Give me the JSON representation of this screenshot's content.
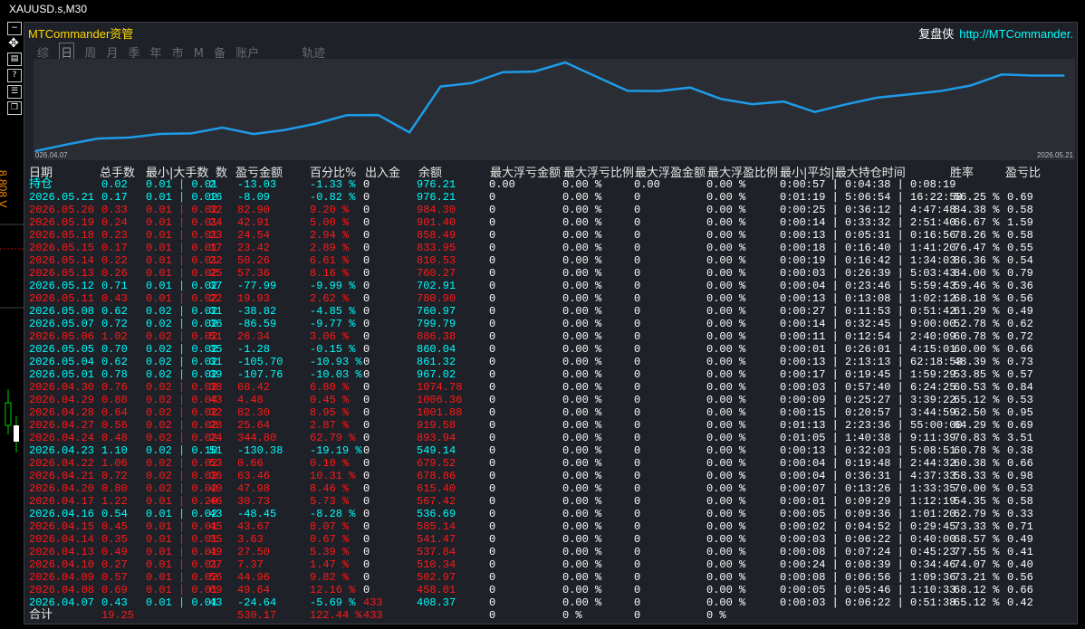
{
  "window": {
    "title": "XAUUSD.s,M30"
  },
  "toolbar_icons": [
    "minimize-icon",
    "move-icon",
    "table-icon",
    "help-icon",
    "settings-icon",
    "restore-icon"
  ],
  "side_label": "8.808 V",
  "panel": {
    "title": "MTCommander资管",
    "brand": "复盘侠",
    "url": "http://MTCommander."
  },
  "tabs": [
    "综",
    "日",
    "周",
    "月",
    "季",
    "年",
    "市",
    "M",
    "备",
    "账户",
    "轨迹"
  ],
  "active_tab": "日",
  "chart_data": {
    "type": "line",
    "x_start_label": "026.04.07",
    "x_end_label": "2026.05.21",
    "x": [
      "2026.04.07",
      "2026.04.08",
      "2026.04.09",
      "2026.04.10",
      "2026.04.13",
      "2026.04.14",
      "2026.04.15",
      "2026.04.16",
      "2026.04.17",
      "2026.04.20",
      "2026.04.21",
      "2026.04.22",
      "2026.04.23",
      "2026.04.24",
      "2026.04.27",
      "2026.04.28",
      "2026.04.29",
      "2026.04.30",
      "2026.05.01",
      "2026.05.04",
      "2026.05.05",
      "2026.05.06",
      "2026.05.07",
      "2026.05.08",
      "2026.05.11",
      "2026.05.12",
      "2026.05.13",
      "2026.05.14",
      "2026.05.15",
      "2026.05.18",
      "2026.05.19",
      "2026.05.20",
      "2026.05.21",
      "2026.05.21"
    ],
    "values": [
      408.37,
      458.01,
      502.97,
      510.34,
      537.84,
      541.47,
      585.14,
      536.69,
      567.42,
      615.4,
      678.86,
      679.52,
      549.14,
      893.94,
      919.58,
      1001.88,
      1006.36,
      1074.78,
      967.02,
      861.32,
      860.04,
      886.38,
      799.79,
      760.97,
      780.9,
      702.91,
      760.27,
      810.53,
      833.95,
      858.49,
      901.4,
      984.3,
      976.21,
      976.21
    ],
    "line_color": "#1e9be8"
  },
  "table": {
    "headers": [
      "日期",
      "总手数",
      "最小|大手数",
      "数",
      "盈亏金额",
      "百分比%",
      "出入金",
      "余额",
      "最大浮亏金额",
      "最大浮亏比例",
      "最大浮盈金额",
      "最大浮盈比例",
      "最小|平均|最大持仓时间",
      "胜率",
      "盈亏比"
    ],
    "rows": [
      {
        "date": "持仓",
        "lots": "0.02",
        "minmax": "0.01 | 0.01",
        "n": "2",
        "pl": "-13.03",
        "pct": "-1.33 %",
        "io": "0",
        "bal": "976.21",
        "mfl": "0.00",
        "mflp": "0.00 %",
        "mfp": "0.00",
        "mfpp": "0.00 %",
        "hold": "0:00:57 | 0:04:38 | 0:08:19",
        "win": "",
        "rr": "",
        "cls": "first"
      },
      {
        "date": "2026.05.21",
        "lots": "0.17",
        "minmax": "0.01 | 0.02",
        "n": "16",
        "pl": "-8.09",
        "pct": "-0.82 %",
        "io": "0",
        "bal": "976.21",
        "mfl": "0",
        "mflp": "0.00 %",
        "mfp": "0",
        "mfpp": "0.00 %",
        "hold": "0:01:19 | 5:06:54 | 16:22:58",
        "win": "56.25 %",
        "rr": "0.69",
        "cls": "pos"
      },
      {
        "date": "2026.05.20",
        "lots": "0.33",
        "minmax": "0.01 | 0.02",
        "n": "32",
        "pl": "82.90",
        "pct": "9.20 %",
        "io": "0",
        "bal": "984.30",
        "mfl": "0",
        "mflp": "0.00 %",
        "mfp": "0",
        "mfpp": "0.00 %",
        "hold": "0:00:25 | 0:36:12 | 4:47:48",
        "win": "84.38 %",
        "rr": "0.58",
        "cls": "neg"
      },
      {
        "date": "2026.05.19",
        "lots": "0.24",
        "minmax": "0.01 | 0.01",
        "n": "24",
        "pl": "42.91",
        "pct": "5.00 %",
        "io": "0",
        "bal": "901.40",
        "mfl": "0",
        "mflp": "0.00 %",
        "mfp": "0",
        "mfpp": "0.00 %",
        "hold": "0:00:14 | 0:33:32 | 2:51:40",
        "win": "66.67 %",
        "rr": "1.59",
        "cls": "neg"
      },
      {
        "date": "2026.05.18",
        "lots": "0.23",
        "minmax": "0.01 | 0.01",
        "n": "23",
        "pl": "24.54",
        "pct": "2.94 %",
        "io": "0",
        "bal": "858.49",
        "mfl": "0",
        "mflp": "0.00 %",
        "mfp": "0",
        "mfpp": "0.00 %",
        "hold": "0:00:13 | 0:05:31 | 0:16:56",
        "win": "78.26 %",
        "rr": "0.58",
        "cls": "neg"
      },
      {
        "date": "2026.05.15",
        "lots": "0.17",
        "minmax": "0.01 | 0.01",
        "n": "17",
        "pl": "23.42",
        "pct": "2.89 %",
        "io": "0",
        "bal": "833.95",
        "mfl": "0",
        "mflp": "0.00 %",
        "mfp": "0",
        "mfpp": "0.00 %",
        "hold": "0:00:18 | 0:16:40 | 1:41:20",
        "win": "76.47 %",
        "rr": "0.55",
        "cls": "neg"
      },
      {
        "date": "2026.05.14",
        "lots": "0.22",
        "minmax": "0.01 | 0.01",
        "n": "22",
        "pl": "50.26",
        "pct": "6.61 %",
        "io": "0",
        "bal": "810.53",
        "mfl": "0",
        "mflp": "0.00 %",
        "mfp": "0",
        "mfpp": "0.00 %",
        "hold": "0:00:19 | 0:16:42 | 1:34:03",
        "win": "86.36 %",
        "rr": "0.54",
        "cls": "neg"
      },
      {
        "date": "2026.05.13",
        "lots": "0.26",
        "minmax": "0.01 | 0.02",
        "n": "25",
        "pl": "57.36",
        "pct": "8.16 %",
        "io": "0",
        "bal": "760.27",
        "mfl": "0",
        "mflp": "0.00 %",
        "mfp": "0",
        "mfpp": "0.00 %",
        "hold": "0:00:03 | 0:26:39 | 5:03:43",
        "win": "84.00 %",
        "rr": "0.79",
        "cls": "neg"
      },
      {
        "date": "2026.05.12",
        "lots": "0.71",
        "minmax": "0.01 | 0.02",
        "n": "37",
        "pl": "-77.99",
        "pct": "-9.99 %",
        "io": "0",
        "bal": "702.91",
        "mfl": "0",
        "mflp": "0.00 %",
        "mfp": "0",
        "mfpp": "0.00 %",
        "hold": "0:00:04 | 0:23:46 | 5:59:43",
        "win": "59.46 %",
        "rr": "0.36",
        "cls": "pos"
      },
      {
        "date": "2026.05.11",
        "lots": "0.43",
        "minmax": "0.01 | 0.02",
        "n": "22",
        "pl": "19.93",
        "pct": "2.62 %",
        "io": "0",
        "bal": "780.90",
        "mfl": "0",
        "mflp": "0.00 %",
        "mfp": "0",
        "mfpp": "0.00 %",
        "hold": "0:00:13 | 0:13:08 | 1:02:12",
        "win": "68.18 %",
        "rr": "0.56",
        "cls": "neg"
      },
      {
        "date": "2026.05.08",
        "lots": "0.62",
        "minmax": "0.02 | 0.02",
        "n": "31",
        "pl": "-38.82",
        "pct": "-4.85 %",
        "io": "0",
        "bal": "760.97",
        "mfl": "0",
        "mflp": "0.00 %",
        "mfp": "0",
        "mfpp": "0.00 %",
        "hold": "0:00:27 | 0:11:53 | 0:51:42",
        "win": "61.29 %",
        "rr": "0.49",
        "cls": "pos"
      },
      {
        "date": "2026.05.07",
        "lots": "0.72",
        "minmax": "0.02 | 0.02",
        "n": "36",
        "pl": "-86.59",
        "pct": "-9.77 %",
        "io": "0",
        "bal": "799.79",
        "mfl": "0",
        "mflp": "0.00 %",
        "mfp": "0",
        "mfpp": "0.00 %",
        "hold": "0:00:14 | 0:32:45 | 9:00:00",
        "win": "52.78 %",
        "rr": "0.62",
        "cls": "pos"
      },
      {
        "date": "2026.05.06",
        "lots": "1.02",
        "minmax": "0.02 | 0.02",
        "n": "51",
        "pl": "26.34",
        "pct": "3.06 %",
        "io": "0",
        "bal": "886.38",
        "mfl": "0",
        "mflp": "0.00 %",
        "mfp": "0",
        "mfpp": "0.00 %",
        "hold": "0:00:11 | 0:12:54 | 2:40:09",
        "win": "60.78 %",
        "rr": "0.72",
        "cls": "neg"
      },
      {
        "date": "2026.05.05",
        "lots": "0.70",
        "minmax": "0.02 | 0.02",
        "n": "35",
        "pl": "-1.28",
        "pct": "-0.15 %",
        "io": "0",
        "bal": "860.04",
        "mfl": "0",
        "mflp": "0.00 %",
        "mfp": "0",
        "mfpp": "0.00 %",
        "hold": "0:00:01 | 0:26:01 | 4:15:01",
        "win": "60.00 %",
        "rr": "0.66",
        "cls": "pos"
      },
      {
        "date": "2026.05.04",
        "lots": "0.62",
        "minmax": "0.02 | 0.02",
        "n": "31",
        "pl": "-105.70",
        "pct": "-10.93 %",
        "io": "0",
        "bal": "861.32",
        "mfl": "0",
        "mflp": "0.00 %",
        "mfp": "0",
        "mfpp": "0.00 %",
        "hold": "0:00:13 | 2:13:13 | 62:18:53",
        "win": "48.39 %",
        "rr": "0.73",
        "cls": "pos"
      },
      {
        "date": "2026.05.01",
        "lots": "0.78",
        "minmax": "0.02 | 0.02",
        "n": "39",
        "pl": "-107.76",
        "pct": "-10.03 %",
        "io": "0",
        "bal": "967.02",
        "mfl": "0",
        "mflp": "0.00 %",
        "mfp": "0",
        "mfpp": "0.00 %",
        "hold": "0:00:17 | 0:19:45 | 1:59:29",
        "win": "53.85 %",
        "rr": "0.57",
        "cls": "pos"
      },
      {
        "date": "2026.04.30",
        "lots": "0.76",
        "minmax": "0.02 | 0.02",
        "n": "38",
        "pl": "68.42",
        "pct": "6.80 %",
        "io": "0",
        "bal": "1074.78",
        "mfl": "0",
        "mflp": "0.00 %",
        "mfp": "0",
        "mfpp": "0.00 %",
        "hold": "0:00:03 | 0:57:40 | 6:24:25",
        "win": "60.53 %",
        "rr": "0.84",
        "cls": "neg"
      },
      {
        "date": "2026.04.29",
        "lots": "0.88",
        "minmax": "0.02 | 0.04",
        "n": "43",
        "pl": "4.48",
        "pct": "0.45 %",
        "io": "0",
        "bal": "1006.36",
        "mfl": "0",
        "mflp": "0.00 %",
        "mfp": "0",
        "mfpp": "0.00 %",
        "hold": "0:00:09 | 0:25:27 | 3:39:22",
        "win": "65.12 %",
        "rr": "0.53",
        "cls": "neg"
      },
      {
        "date": "2026.04.28",
        "lots": "0.64",
        "minmax": "0.02 | 0.02",
        "n": "32",
        "pl": "82.30",
        "pct": "8.95 %",
        "io": "0",
        "bal": "1001.88",
        "mfl": "0",
        "mflp": "0.00 %",
        "mfp": "0",
        "mfpp": "0.00 %",
        "hold": "0:00:15 | 0:20:57 | 3:44:59",
        "win": "62.50 %",
        "rr": "0.95",
        "cls": "neg"
      },
      {
        "date": "2026.04.27",
        "lots": "0.56",
        "minmax": "0.02 | 0.02",
        "n": "28",
        "pl": "25.64",
        "pct": "2.87 %",
        "io": "0",
        "bal": "919.58",
        "mfl": "0",
        "mflp": "0.00 %",
        "mfp": "0",
        "mfpp": "0.00 %",
        "hold": "0:01:13 | 2:23:36 | 55:00:00",
        "win": "64.29 %",
        "rr": "0.69",
        "cls": "neg"
      },
      {
        "date": "2026.04.24",
        "lots": "0.48",
        "minmax": "0.02 | 0.02",
        "n": "24",
        "pl": "344.80",
        "pct": "62.79 %",
        "io": "0",
        "bal": "893.94",
        "mfl": "0",
        "mflp": "0.00 %",
        "mfp": "0",
        "mfpp": "0.00 %",
        "hold": "0:01:05 | 1:40:38 | 9:11:39",
        "win": "70.83 %",
        "rr": "3.51",
        "cls": "neg"
      },
      {
        "date": "2026.04.23",
        "lots": "1.10",
        "minmax": "0.02 | 0.10",
        "n": "51",
        "pl": "-130.38",
        "pct": "-19.19 %",
        "io": "0",
        "bal": "549.14",
        "mfl": "0",
        "mflp": "0.00 %",
        "mfp": "0",
        "mfpp": "0.00 %",
        "hold": "0:00:13 | 0:32:03 | 5:08:51",
        "win": "60.78 %",
        "rr": "0.38",
        "cls": "pos"
      },
      {
        "date": "2026.04.22",
        "lots": "1.06",
        "minmax": "0.02 | 0.02",
        "n": "53",
        "pl": "0.66",
        "pct": "0.10 %",
        "io": "0",
        "bal": "679.52",
        "mfl": "0",
        "mflp": "0.00 %",
        "mfp": "0",
        "mfpp": "0.00 %",
        "hold": "0:00:04 | 0:19:48 | 2:44:32",
        "win": "60.38 %",
        "rr": "0.66",
        "cls": "neg"
      },
      {
        "date": "2026.04.21",
        "lots": "0.72",
        "minmax": "0.02 | 0.02",
        "n": "36",
        "pl": "63.46",
        "pct": "10.31 %",
        "io": "0",
        "bal": "678.86",
        "mfl": "0",
        "mflp": "0.00 %",
        "mfp": "0",
        "mfpp": "0.00 %",
        "hold": "0:00:04 | 0:36:31 | 4:37:33",
        "win": "58.33 %",
        "rr": "0.98",
        "cls": "neg"
      },
      {
        "date": "2026.04.20",
        "lots": "0.80",
        "minmax": "0.02 | 0.02",
        "n": "40",
        "pl": "47.98",
        "pct": "8.46 %",
        "io": "0",
        "bal": "615.40",
        "mfl": "0",
        "mflp": "0.00 %",
        "mfp": "0",
        "mfpp": "0.00 %",
        "hold": "0:00:07 | 0:13:26 | 1:33:35",
        "win": "70.00 %",
        "rr": "0.53",
        "cls": "neg"
      },
      {
        "date": "2026.04.17",
        "lots": "1.22",
        "minmax": "0.01 | 0.20",
        "n": "46",
        "pl": "30.73",
        "pct": "5.73 %",
        "io": "0",
        "bal": "567.42",
        "mfl": "0",
        "mflp": "0.00 %",
        "mfp": "0",
        "mfpp": "0.00 %",
        "hold": "0:00:01 | 0:09:29 | 1:12:19",
        "win": "54.35 %",
        "rr": "0.58",
        "cls": "neg"
      },
      {
        "date": "2026.04.16",
        "lots": "0.54",
        "minmax": "0.01 | 0.02",
        "n": "43",
        "pl": "-48.45",
        "pct": "-8.28 %",
        "io": "0",
        "bal": "536.69",
        "mfl": "0",
        "mflp": "0.00 %",
        "mfp": "0",
        "mfpp": "0.00 %",
        "hold": "0:00:05 | 0:09:36 | 1:01:20",
        "win": "62.79 %",
        "rr": "0.33",
        "cls": "pos"
      },
      {
        "date": "2026.04.15",
        "lots": "0.45",
        "minmax": "0.01 | 0.01",
        "n": "45",
        "pl": "43.67",
        "pct": "8.07 %",
        "io": "0",
        "bal": "585.14",
        "mfl": "0",
        "mflp": "0.00 %",
        "mfp": "0",
        "mfpp": "0.00 %",
        "hold": "0:00:02 | 0:04:52 | 0:29:45",
        "win": "73.33 %",
        "rr": "0.71",
        "cls": "neg"
      },
      {
        "date": "2026.04.14",
        "lots": "0.35",
        "minmax": "0.01 | 0.01",
        "n": "35",
        "pl": "3.63",
        "pct": "0.67 %",
        "io": "0",
        "bal": "541.47",
        "mfl": "0",
        "mflp": "0.00 %",
        "mfp": "0",
        "mfpp": "0.00 %",
        "hold": "0:00:03 | 0:06:22 | 0:40:00",
        "win": "68.57 %",
        "rr": "0.49",
        "cls": "neg"
      },
      {
        "date": "2026.04.13",
        "lots": "0.49",
        "minmax": "0.01 | 0.01",
        "n": "49",
        "pl": "27.50",
        "pct": "5.39 %",
        "io": "0",
        "bal": "537.84",
        "mfl": "0",
        "mflp": "0.00 %",
        "mfp": "0",
        "mfpp": "0.00 %",
        "hold": "0:00:08 | 0:07:24 | 0:45:23",
        "win": "77.55 %",
        "rr": "0.41",
        "cls": "neg"
      },
      {
        "date": "2026.04.10",
        "lots": "0.27",
        "minmax": "0.01 | 0.01",
        "n": "27",
        "pl": "7.37",
        "pct": "1.47 %",
        "io": "0",
        "bal": "510.34",
        "mfl": "0",
        "mflp": "0.00 %",
        "mfp": "0",
        "mfpp": "0.00 %",
        "hold": "0:00:24 | 0:08:39 | 0:34:46",
        "win": "74.07 %",
        "rr": "0.40",
        "cls": "neg"
      },
      {
        "date": "2026.04.09",
        "lots": "0.57",
        "minmax": "0.01 | 0.02",
        "n": "56",
        "pl": "44.96",
        "pct": "9.82 %",
        "io": "0",
        "bal": "502.97",
        "mfl": "0",
        "mflp": "0.00 %",
        "mfp": "0",
        "mfpp": "0.00 %",
        "hold": "0:00:08 | 0:06:56 | 1:09:36",
        "win": "73.21 %",
        "rr": "0.56",
        "cls": "neg"
      },
      {
        "date": "2026.04.08",
        "lots": "0.69",
        "minmax": "0.01 | 0.01",
        "n": "69",
        "pl": "49.64",
        "pct": "12.16 %",
        "io": "0",
        "bal": "458.01",
        "mfl": "0",
        "mflp": "0.00 %",
        "mfp": "0",
        "mfpp": "0.00 %",
        "hold": "0:00:05 | 0:05:46 | 1:10:33",
        "win": "68.12 %",
        "rr": "0.66",
        "cls": "neg"
      },
      {
        "date": "2026.04.07",
        "lots": "0.43",
        "minmax": "0.01 | 0.01",
        "n": "43",
        "pl": "-24.64",
        "pct": "-5.69 %",
        "io": "433",
        "bal": "408.37",
        "mfl": "0",
        "mflp": "0.00 %",
        "mfp": "0",
        "mfpp": "0.00 %",
        "hold": "0:00:03 | 0:06:22 | 0:51:38",
        "win": "65.12 %",
        "rr": "0.42",
        "cls": "pos"
      }
    ],
    "total": {
      "label": "合计",
      "lots": "19.25",
      "pl": "530.17",
      "pct": "122.44 %",
      "io": "433",
      "mfl": "0",
      "mflp": "0 %",
      "mfp": "0",
      "mfpp": "0 %"
    }
  }
}
